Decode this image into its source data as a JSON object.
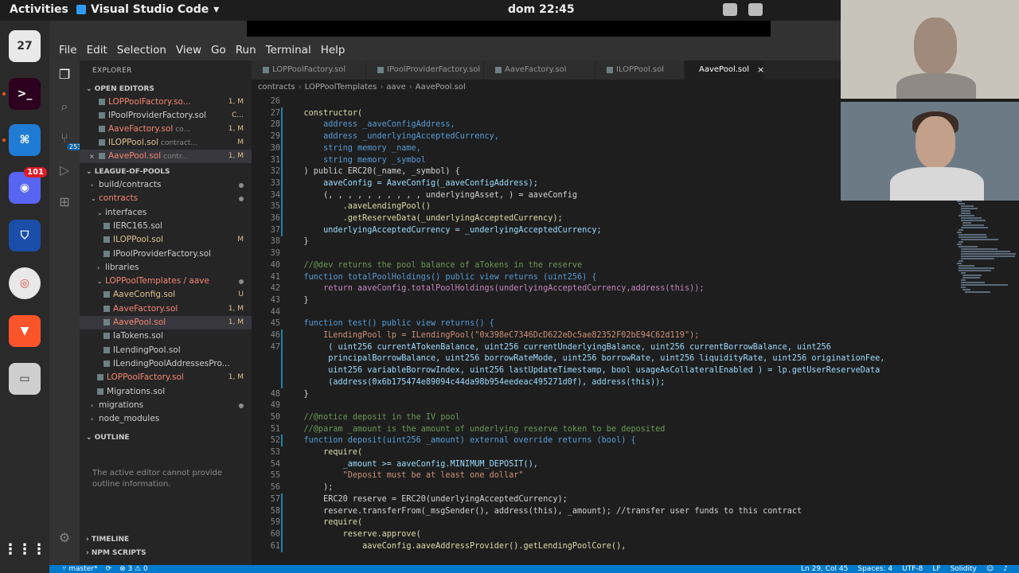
{
  "topbar": {
    "activities": "Activities",
    "app_name": "Visual Studio Code",
    "app_menu_caret": "▾",
    "clock": "dom 22:45"
  },
  "dock": {
    "calendar_day": "27",
    "discord_badge": "101",
    "vscode_badge": "253"
  },
  "menubar": [
    "File",
    "Edit",
    "Selection",
    "View",
    "Go",
    "Run",
    "Terminal",
    "Help"
  ],
  "sidebar": {
    "explorer_title": "EXPLORER",
    "open_editors_title": "OPEN EDITORS",
    "open_editors": [
      {
        "name": "LOPPoolFactory.so...",
        "status": "1, M",
        "color": "red"
      },
      {
        "name": "IPoolProviderFactory.sol",
        "status": "C...",
        "color": "plain",
        "desc": ""
      },
      {
        "name": "AaveFactory.sol",
        "desc": "co...",
        "status": "1, M",
        "color": "red"
      },
      {
        "name": "ILOPPool.sol",
        "desc": "contract...",
        "status": "M",
        "color": "mod"
      },
      {
        "name": "AavePool.sol",
        "desc": "contr...",
        "status": "1, M",
        "color": "red"
      }
    ],
    "project_title": "LEAGUE-OF-POOLS",
    "tree": [
      {
        "name": "build/contracts",
        "indent": 1,
        "chev": "›",
        "status_dot": true
      },
      {
        "name": "contracts",
        "indent": 1,
        "chev": "⌄",
        "color": "red",
        "status_dot": true
      },
      {
        "name": "interfaces",
        "indent": 2,
        "chev": "⌄",
        "status_dot": false
      },
      {
        "name": "IERC165.sol",
        "indent": 3,
        "icon": true
      },
      {
        "name": "ILOPPool.sol",
        "indent": 3,
        "icon": true,
        "status": "M",
        "color": "mod"
      },
      {
        "name": "IPoolProviderFactory.sol",
        "indent": 3,
        "icon": true
      },
      {
        "name": "libraries",
        "indent": 2,
        "chev": "›"
      },
      {
        "name": "LOPPoolTemplates / aave",
        "indent": 2,
        "chev": "⌄",
        "color": "red",
        "status_dot": true
      },
      {
        "name": "AaveConfig.sol",
        "indent": 3,
        "icon": true,
        "status": "U",
        "color": "mod"
      },
      {
        "name": "AaveFactory.sol",
        "indent": 3,
        "icon": true,
        "status": "1, M",
        "color": "red"
      },
      {
        "name": "AavePool.sol",
        "indent": 3,
        "icon": true,
        "status": "1, M",
        "color": "red",
        "selected": true
      },
      {
        "name": "IaTokens.sol",
        "indent": 3,
        "icon": true
      },
      {
        "name": "ILendingPool.sol",
        "indent": 3,
        "icon": true
      },
      {
        "name": "ILendingPoolAddressesPro...",
        "indent": 3,
        "icon": true
      },
      {
        "name": "LOPPoolFactory.sol",
        "indent": 2,
        "icon": true,
        "status": "1, M",
        "color": "red"
      },
      {
        "name": "Migrations.sol",
        "indent": 2,
        "icon": true
      },
      {
        "name": "migrations",
        "indent": 1,
        "chev": "›",
        "status_dot": true
      },
      {
        "name": "node_modules",
        "indent": 1,
        "chev": "›"
      }
    ],
    "outline_title": "OUTLINE",
    "outline_msg": "The active editor cannot provide outline information.",
    "timeline_title": "TIMELINE",
    "npm_title": "NPM SCRIPTS"
  },
  "tabs": [
    {
      "label": "LOPPoolFactory.sol",
      "active": false
    },
    {
      "label": "IPoolProviderFactory.sol",
      "active": false
    },
    {
      "label": "AaveFactory.sol",
      "active": false
    },
    {
      "label": "ILOPPool.sol",
      "active": false
    },
    {
      "label": "AavePool.sol",
      "active": true,
      "close": "×"
    }
  ],
  "breadcrumb": [
    "contracts",
    "LOPPoolTemplates",
    "aave",
    "AavePool.sol"
  ],
  "editor": {
    "lines": [
      {
        "n": "26",
        "t": "",
        "c": "plain"
      },
      {
        "n": "27",
        "t": "    constructor(",
        "c": "fn",
        "g": "mod"
      },
      {
        "n": "28",
        "t": "        address _aaveConfigAddress,",
        "c": "kw",
        "g": "mod"
      },
      {
        "n": "29",
        "t": "        address _underlyingAcceptedCurrency,",
        "c": "kw",
        "g": "mod"
      },
      {
        "n": "30",
        "t": "        string memory _name,",
        "c": "kw",
        "g": "mod"
      },
      {
        "n": "31",
        "t": "        string memory _symbol",
        "c": "kw",
        "g": "mod"
      },
      {
        "n": "32",
        "t": "    ) public ERC20(_name, _symbol) {",
        "c": "plain",
        "g": "mod"
      },
      {
        "n": "33",
        "t": "        aaveConfig = AaveConfig(_aaveConfigAddress);",
        "c": "var",
        "g": "mod"
      },
      {
        "n": "34",
        "t": "        (, , , , , , , , , , underlyingAsset, ) = aaveConfig",
        "c": "plain",
        "g": "mod"
      },
      {
        "n": "35",
        "t": "            .aaveLendingPool()",
        "c": "fn",
        "g": "mod"
      },
      {
        "n": "36",
        "t": "            .getReserveData(_underlyingAcceptedCurrency);",
        "c": "fn",
        "g": "mod"
      },
      {
        "n": "37",
        "t": "        underlyingAcceptedCurrency = _underlyingAcceptedCurrency;",
        "c": "var",
        "g": "mod"
      },
      {
        "n": "38",
        "t": "    }",
        "c": "plain"
      },
      {
        "n": "39",
        "t": "",
        "c": "plain"
      },
      {
        "n": "40",
        "t": "    //@dev returns the pool balance of aTokens in the reserve",
        "c": "cm"
      },
      {
        "n": "41",
        "t": "    function totalPoolHoldings() public view returns (uint256) {",
        "c": "kw"
      },
      {
        "n": "42",
        "t": "        return aaveConfig.totalPoolHoldings(underlyingAcceptedCurrency,address(this));",
        "c": "ctl"
      },
      {
        "n": "43",
        "t": "    }",
        "c": "plain"
      },
      {
        "n": "44",
        "t": "",
        "c": "plain"
      },
      {
        "n": "45",
        "t": "    function test() public view returns() {",
        "c": "kw"
      },
      {
        "n": "46",
        "t": "        ILendingPool lp = ILendingPool(\"0x398eC7346DcD622eDc5ae82352F02bE94C62d119\");",
        "c": "str",
        "g": "mod"
      },
      {
        "n": "47",
        "t": "         ( uint256 currentATokenBalance, uint256 currentUnderlyingBalance, uint256 currentBorrowBalance, uint256",
        "c": "var",
        "g": "mod"
      },
      {
        "n": "",
        "t": "         principalBorrowBalance, uint256 borrowRateMode, uint256 borrowRate, uint256 liquidityRate, uint256 originationFee,",
        "c": "var",
        "g": "mod"
      },
      {
        "n": "",
        "t": "         uint256 variableBorrowIndex, uint256 lastUpdateTimestamp, bool usageAsCollateralEnabled ) = lp.getUserReserveData",
        "c": "var",
        "g": "mod"
      },
      {
        "n": "",
        "t": "         (address(0x6b175474e89094c44da98b954eedeac495271d0f), address(this));",
        "c": "var",
        "g": "mod"
      },
      {
        "n": "48",
        "t": "    }",
        "c": "plain"
      },
      {
        "n": "49",
        "t": "",
        "c": "plain"
      },
      {
        "n": "50",
        "t": "    //@notice deposit in the IV pool",
        "c": "cm"
      },
      {
        "n": "51",
        "t": "    //@param _amount is the amount of underlying reserve token to be deposited",
        "c": "cm"
      },
      {
        "n": "52",
        "t": "    function deposit(uint256 _amount) external override returns (bool) {",
        "c": "kw",
        "g": "mod"
      },
      {
        "n": "53",
        "t": "        require(",
        "c": "fn"
      },
      {
        "n": "54",
        "t": "            _amount >= aaveConfig.MINIMUM_DEPOSIT(),",
        "c": "var"
      },
      {
        "n": "55",
        "t": "            \"Deposit must be at least one dollar\"",
        "c": "str"
      },
      {
        "n": "56",
        "t": "        );",
        "c": "plain"
      },
      {
        "n": "57",
        "t": "        ERC20 reserve = ERC20(underlyingAcceptedCurrency);",
        "c": "plain",
        "g": "mod"
      },
      {
        "n": "58",
        "t": "        reserve.transferFrom(_msgSender(), address(this), _amount); //transfer user funds to this contract",
        "c": "plain",
        "g": "mod"
      },
      {
        "n": "59",
        "t": "        require(",
        "c": "fn",
        "g": "mod"
      },
      {
        "n": "60",
        "t": "            reserve.approve(",
        "c": "fn",
        "g": "mod"
      },
      {
        "n": "61",
        "t": "                aaveConfig.aaveAddressProvider().getLendingPoolCore(),",
        "c": "fn",
        "g": "mod"
      }
    ]
  },
  "statusbar": {
    "branch": "master*",
    "sync": "⟳",
    "problems": "⊗ 3 ⚠ 0",
    "position": "Ln 29, Col 45",
    "spaces": "Spaces: 4",
    "encoding": "UTF-8",
    "eol": "LF",
    "language": "Solidity"
  },
  "colors": {
    "accent": "#007acc",
    "modified_gutter": "#1b81a8",
    "badge": "#e01b24"
  }
}
